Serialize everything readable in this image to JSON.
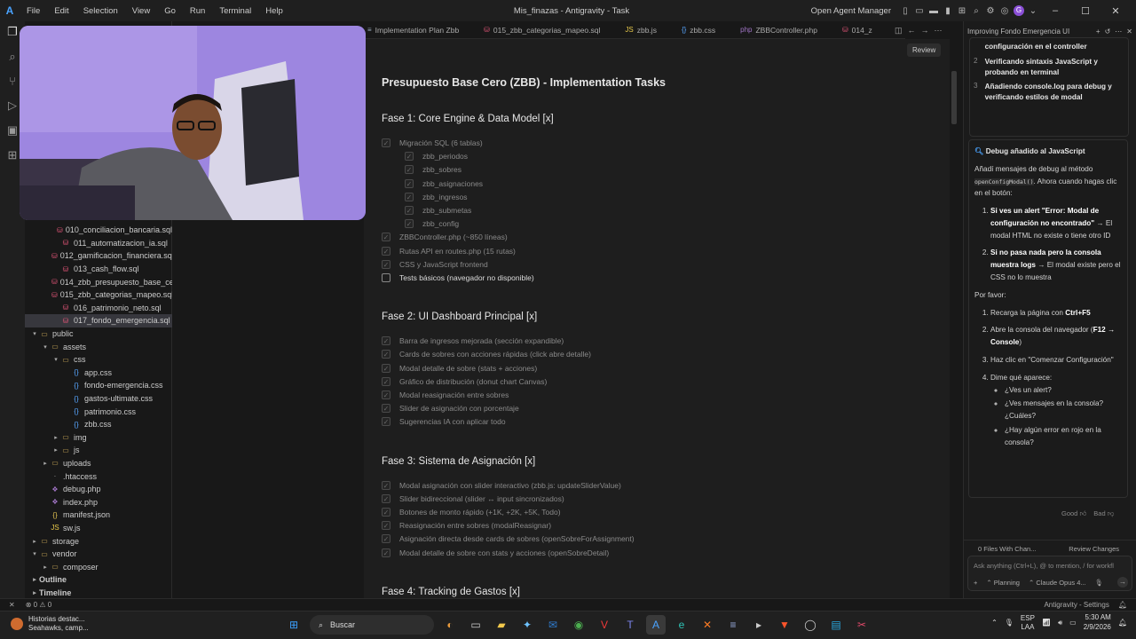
{
  "app": {
    "title": "Mis_finazas - Antigravity - Task",
    "menus": [
      "File",
      "Edit",
      "Selection",
      "View",
      "Go",
      "Run",
      "Terminal",
      "Help"
    ],
    "open_agent_manager": "Open Agent Manager",
    "avatar_letter": "G"
  },
  "explorer": {
    "items": [
      {
        "label": "010_conciliacion_bancaria.sql",
        "indent": 2,
        "kind": "sql"
      },
      {
        "label": "011_automatizacion_ia.sql",
        "indent": 2,
        "kind": "sql"
      },
      {
        "label": "012_gamificacion_financiera.sql",
        "indent": 2,
        "kind": "sql"
      },
      {
        "label": "013_cash_flow.sql",
        "indent": 2,
        "kind": "sql"
      },
      {
        "label": "014_zbb_presupuesto_base_ce...",
        "indent": 2,
        "kind": "sql"
      },
      {
        "label": "015_zbb_categorias_mapeo.sql",
        "indent": 2,
        "kind": "sql"
      },
      {
        "label": "016_patrimonio_neto.sql",
        "indent": 2,
        "kind": "sql"
      },
      {
        "label": "017_fondo_emergencia.sql",
        "indent": 2,
        "kind": "sql",
        "selected": true
      },
      {
        "label": "public",
        "indent": 0,
        "kind": "folder",
        "open": true
      },
      {
        "label": "assets",
        "indent": 1,
        "kind": "folder",
        "open": true
      },
      {
        "label": "css",
        "indent": 2,
        "kind": "folder",
        "open": true
      },
      {
        "label": "app.css",
        "indent": 3,
        "kind": "css"
      },
      {
        "label": "fondo-emergencia.css",
        "indent": 3,
        "kind": "css"
      },
      {
        "label": "gastos-ultimate.css",
        "indent": 3,
        "kind": "css"
      },
      {
        "label": "patrimonio.css",
        "indent": 3,
        "kind": "css"
      },
      {
        "label": "zbb.css",
        "indent": 3,
        "kind": "css"
      },
      {
        "label": "img",
        "indent": 2,
        "kind": "folder"
      },
      {
        "label": "js",
        "indent": 2,
        "kind": "folder"
      },
      {
        "label": "uploads",
        "indent": 1,
        "kind": "folder"
      },
      {
        "label": ".htaccess",
        "indent": 1,
        "kind": "file"
      },
      {
        "label": "debug.php",
        "indent": 1,
        "kind": "php"
      },
      {
        "label": "index.php",
        "indent": 1,
        "kind": "php"
      },
      {
        "label": "manifest.json",
        "indent": 1,
        "kind": "json"
      },
      {
        "label": "sw.js",
        "indent": 1,
        "kind": "js"
      },
      {
        "label": "storage",
        "indent": 0,
        "kind": "folder"
      },
      {
        "label": "vendor",
        "indent": 0,
        "kind": "folder",
        "open": true
      },
      {
        "label": "composer",
        "indent": 1,
        "kind": "folder"
      },
      {
        "label": "Outline",
        "indent": -1,
        "kind": "section"
      },
      {
        "label": "Timeline",
        "indent": -1,
        "kind": "section"
      }
    ]
  },
  "tabs": [
    {
      "label": "Implementation Plan Zbb",
      "icon": "≡"
    },
    {
      "label": "015_zbb_categorias_mapeo.sql",
      "icon": "⛁"
    },
    {
      "label": "zbb.js",
      "icon": "JS"
    },
    {
      "label": "zbb.css",
      "icon": "{}"
    },
    {
      "label": "ZBBController.php",
      "icon": "php"
    },
    {
      "label": "014_z",
      "icon": "⛁"
    }
  ],
  "review_label": "Review",
  "doc": {
    "title": "Presupuesto Base Cero (ZBB) - Implementation Tasks",
    "phases": [
      {
        "title": "Fase 1: Core Engine & Data Model [x]",
        "tasks": [
          {
            "text": "Migración SQL (6 tablas)",
            "done": true,
            "level": 0
          },
          {
            "text": "zbb_periodos",
            "done": true,
            "level": 1
          },
          {
            "text": "zbb_sobres",
            "done": true,
            "level": 1
          },
          {
            "text": "zbb_asignaciones",
            "done": true,
            "level": 1
          },
          {
            "text": "zbb_ingresos",
            "done": true,
            "level": 1
          },
          {
            "text": "zbb_submetas",
            "done": true,
            "level": 1
          },
          {
            "text": "zbb_config",
            "done": true,
            "level": 1
          },
          {
            "text": "ZBBController.php (~850 líneas)",
            "done": true,
            "level": 0
          },
          {
            "text": "Rutas API en routes.php (15 rutas)",
            "done": true,
            "level": 0
          },
          {
            "text": "CSS y JavaScript frontend",
            "done": true,
            "level": 0
          },
          {
            "text": "Tests básicos (navegador no disponible)",
            "done": false,
            "level": 0
          }
        ]
      },
      {
        "title": "Fase 2: UI Dashboard Principal [x]",
        "tasks": [
          {
            "text": "Barra de ingresos mejorada (sección expandible)",
            "done": true,
            "level": 0
          },
          {
            "text": "Cards de sobres con acciones rápidas (click abre detalle)",
            "done": true,
            "level": 0
          },
          {
            "text": "Modal detalle de sobre (stats + acciones)",
            "done": true,
            "level": 0
          },
          {
            "text": "Gráfico de distribución (donut chart Canvas)",
            "done": true,
            "level": 0
          },
          {
            "text": "Modal reasignación entre sobres",
            "done": true,
            "level": 0
          },
          {
            "text": "Slider de asignación con porcentaje",
            "done": true,
            "level": 0
          },
          {
            "text": "Sugerencias IA con aplicar todo",
            "done": true,
            "level": 0
          }
        ]
      },
      {
        "title": "Fase 3: Sistema de Asignación [x]",
        "tasks": [
          {
            "text": "Modal asignación con slider interactivo (zbb.js: updateSliderValue)",
            "done": true,
            "level": 0
          },
          {
            "text": "Slider bidireccional (slider ↔ input sincronizados)",
            "done": true,
            "level": 0
          },
          {
            "text": "Botones de monto rápido (+1K, +2K, +5K, Todo)",
            "done": true,
            "level": 0
          },
          {
            "text": "Reasignación entre sobres (modalReasignar)",
            "done": true,
            "level": 0
          },
          {
            "text": "Asignación directa desde cards de sobres (openSobreForAssignment)",
            "done": true,
            "level": 0
          },
          {
            "text": "Modal detalle de sobre con stats y acciones (openSobreDetail)",
            "done": true,
            "level": 0
          }
        ]
      },
      {
        "title": "Fase 4: Tracking de Gastos [x]",
        "tasks": []
      }
    ]
  },
  "chat": {
    "header": "Improving Fondo Emergencia UI",
    "steps": [
      {
        "n": "1",
        "text": "Buscando el HTML del botón de configuración en el controller"
      },
      {
        "n": "2",
        "text": "Verificando sintaxis JavaScript y probando en terminal"
      },
      {
        "n": "3",
        "text": "Añadiendo console.log para debug y verificando estilos de modal"
      }
    ],
    "msg_title": "Debug añadido al JavaScript",
    "intro_a": "Añadí mensajes de debug al método",
    "intro_code": "openConfigModal()",
    "intro_b": ". Ahora cuando hagas clic en el botón:",
    "cases": [
      {
        "bold": "Si ves un alert \"Error: Modal de configuración no encontrado\"",
        "rest": " → El modal HTML no existe o tiene otro ID"
      },
      {
        "bold": "Si no pasa nada pero la consola muestra logs",
        "rest": " → El modal existe pero el CSS no lo muestra"
      }
    ],
    "please": "Por favor:",
    "todo": [
      {
        "a": "Recarga la página con ",
        "b": "Ctrl+F5",
        "c": ""
      },
      {
        "a": "Abre la consola del navegador (",
        "b": "F12 → Console",
        "c": ")"
      },
      {
        "a": "Haz clic en \"Comenzar Configuración\"",
        "b": "",
        "c": ""
      },
      {
        "a": "Dime qué aparece:",
        "b": "",
        "c": ""
      }
    ],
    "questions": [
      "¿Ves un alert?",
      "¿Ves mensajes en la consola? ¿Cuáles?",
      "¿Hay algún error en rojo en la consola?"
    ],
    "good": "Good",
    "bad": "Bad",
    "files_changed": "0 Files With Chan...",
    "review_changes": "Review Changes",
    "ask_placeholder": "Ask anything (Ctrl+L), @ to mention, / for workfl",
    "mode": "Planning",
    "model": "Claude Opus 4..."
  },
  "status": {
    "errors": "0",
    "warnings": "0",
    "right": "Antigravity - Settings"
  },
  "taskbar": {
    "weather_title": "Historias destac...",
    "weather_sub": "Seahawks, camp...",
    "search": "Buscar",
    "lang": "ESP",
    "lang2": "LAA",
    "time": "5:30 AM",
    "date": "2/9/2026"
  },
  "colors": {
    "accent": "#4aa3ff",
    "avatar": "#8a4fd6",
    "webcam_bg": "#8b74d8"
  }
}
